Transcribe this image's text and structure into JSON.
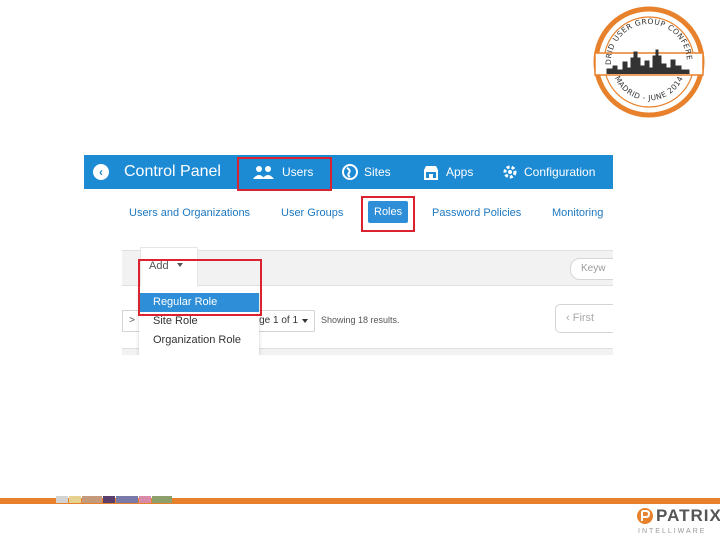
{
  "seal": {
    "top_text": "MADRID USER GROUP CONFERENCE",
    "bottom_text": "MADRID - JUNE 2014",
    "colors": {
      "ring": "#e8812b",
      "skyline": "#333333"
    }
  },
  "app": {
    "title": "Control Panel",
    "back_icon": "back-arrow-circle-icon",
    "top_nav": [
      {
        "label": "Users",
        "icon": "users-icon"
      },
      {
        "label": "Sites",
        "icon": "globe-icon"
      },
      {
        "label": "Apps",
        "icon": "store-icon"
      },
      {
        "label": "Configuration",
        "icon": "gear-icon"
      }
    ],
    "sub_nav": [
      {
        "label": "Users and Organizations"
      },
      {
        "label": "User Groups"
      },
      {
        "label": "Roles",
        "active": true
      },
      {
        "label": "Password Policies"
      },
      {
        "label": "Monitoring"
      }
    ],
    "toolbar": {
      "add_label": "Add",
      "keyword_placeholder": "Keyw"
    },
    "add_menu": [
      {
        "label": "Regular Role",
        "selected": true
      },
      {
        "label": "Site Role"
      },
      {
        "label": "Organization Role"
      }
    ],
    "pager": {
      "left_fragment": ">",
      "page_label": "ge 1 of 1",
      "results_text": "Showing 18 results.",
      "first_label": "First",
      "first_icon": "chevron-left-icon"
    },
    "colors": {
      "topbar": "#1d8ad4",
      "active_tab": "#2e8fd8",
      "link": "#1d78c1",
      "highlight": "#d9232e"
    }
  },
  "footer": {
    "brand_name": "PATRIX",
    "brand_sub": "INTELLIWARE",
    "accent": "#e8812b",
    "swatches": [
      "#d3d3d3",
      "#e6d28e",
      "#c49a7a",
      "#5a3e6b",
      "#7a7aa8",
      "#d88aa8",
      "#8da06b"
    ]
  }
}
